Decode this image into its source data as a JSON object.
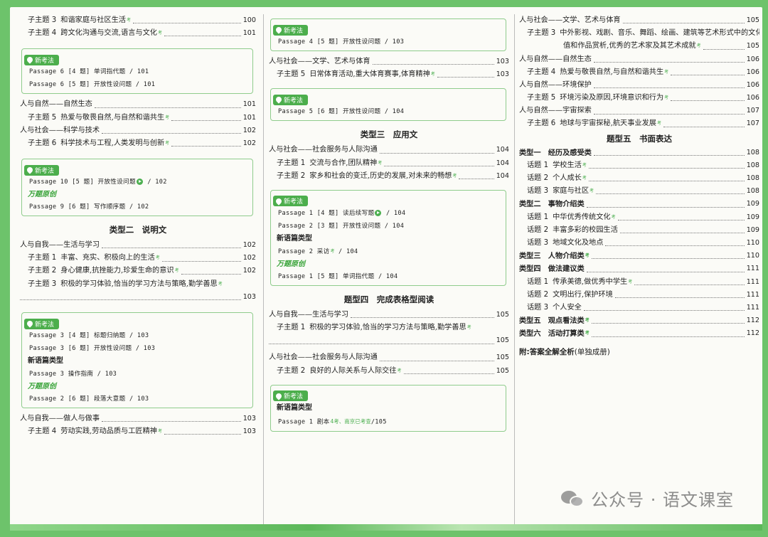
{
  "col1": {
    "r1": {
      "num": "子主题 3",
      "text": "和谐家庭与社区生活",
      "page": "100"
    },
    "r2": {
      "num": "子主题 4",
      "text": "跨文化沟通与交流,语言与文化",
      "page": "101"
    },
    "box1": {
      "badge": "新考法",
      "p1": "Passage 6 [4 题] 单词指代题 / 101",
      "p2": "Passage 6 [5 题] 开放性设问题 / 101"
    },
    "r3": {
      "text": "人与自然——自然生态",
      "page": "101"
    },
    "r4": {
      "num": "子主题 5",
      "text": "热爱与敬畏自然,与自然和谐共生",
      "page": "101"
    },
    "r5": {
      "text": "人与社会——科学与技术",
      "page": "102"
    },
    "r6": {
      "num": "子主题 6",
      "text": "科学技术与工程,人类发明与创新",
      "page": "102"
    },
    "box2": {
      "badge": "新考法",
      "p1": "Passage 10 [5 题] 开放性设问题",
      "p1b": " / 102",
      "label": "万题原创",
      "p2": "Passage 9 [6 题] 写作顺序题 / 102"
    },
    "sec": "类型二　说明文",
    "r7": {
      "text": "人与自我——生活与学习",
      "page": "102"
    },
    "r8": {
      "num": "子主题 1",
      "text": "丰富、充实、积极向上的生活",
      "page": "102"
    },
    "r9": {
      "num": "子主题 2",
      "text": "身心健康,抗挫能力,珍爱生命的意识",
      "page": "102"
    },
    "r10": {
      "num": "子主题 3",
      "text": "积极的学习体验,恰当的学习方法与策略,勤学善思",
      "page": "103"
    },
    "box3": {
      "badge": "新考法",
      "p1": "Passage 3 [4 题] 标题归纳题 / 103",
      "p2": "Passage 3 [6 题] 开放性设问题 / 103",
      "sub": "新语篇类型",
      "p3": "Passage 3 操作指南 / 103",
      "label": "万题原创",
      "p4": "Passage 2 [6 题] 段落大意题 / 103"
    },
    "r11": {
      "text": "人与自我——做人与做事",
      "page": "103"
    },
    "r12": {
      "num": "子主题 4",
      "text": "劳动实践,劳动品质与工匠精神",
      "page": "103"
    }
  },
  "col2": {
    "box1": {
      "badge": "新考法",
      "p1": "Passage 4 [5 题] 开放性设问题 / 103"
    },
    "r1": {
      "text": "人与社会——文学、艺术与体育",
      "page": "103"
    },
    "r2": {
      "num": "子主题 5",
      "text": "日常体育活动,重大体育赛事,体育精神",
      "page": "103"
    },
    "box2": {
      "badge": "新考法",
      "p1": "Passage 5 [6 题] 开放性设问题 / 104"
    },
    "sec1": "类型三　应用文",
    "r3": {
      "text": "人与社会——社会服务与人际沟通",
      "page": "104"
    },
    "r4": {
      "num": "子主题 1",
      "text": "交流与合作,团队精神",
      "page": "104"
    },
    "r5": {
      "num": "子主题 2",
      "text": "家乡和社会的变迁,历史的发展,对未来的畅想",
      "page": "104"
    },
    "box3": {
      "badge": "新考法",
      "p1": "Passage 1 [4 题] 读后续写题",
      "p1b": " / 104",
      "p2": "Passage 2 [3 题] 开放性设问题 / 104",
      "sub": "新语篇类型",
      "p3": "Passage 2 采访",
      "p3b": " / 104",
      "label": "万题原创",
      "p4": "Passage 1 [5 题] 单词指代题 / 104"
    },
    "sec2": "题型四　完成表格型阅读",
    "r6": {
      "text": "人与自我——生活与学习",
      "page": "105"
    },
    "r7": {
      "num": "子主题 1",
      "text": "积极的学习体验,恰当的学习方法与策略,勤学善思",
      "page": "105"
    },
    "r8": {
      "text": "人与社会——社会服务与人际沟通",
      "page": "105"
    },
    "r9": {
      "num": "子主题 2",
      "text": "良好的人际关系与人际交往",
      "page": "105"
    },
    "box4": {
      "badge": "新考法",
      "sub": "新语篇类型",
      "p1": "Passage 1 剧本",
      "tag": "4考、南京已考查",
      "p1b": "/105"
    }
  },
  "col3": {
    "r1": {
      "text": "人与社会——文学、艺术与体育",
      "page": "105"
    },
    "r2": {
      "num": "子主题 3",
      "text": "中外影视、戏剧、音乐、舞蹈、绘画、建筑等艺术形式中的文化价",
      "text2": "值和作品赏析,优秀的艺术家及其艺术成就",
      "page": "105"
    },
    "r3": {
      "text": "人与自然——自然生态",
      "page": "106"
    },
    "r4": {
      "num": "子主题 4",
      "text": "热爱与敬畏自然,与自然和谐共生",
      "page": "106"
    },
    "r5": {
      "text": "人与自然——环境保护",
      "page": "106"
    },
    "r6": {
      "num": "子主题 5",
      "text": "环境污染及原因,环境意识和行为",
      "page": "106"
    },
    "r7": {
      "text": "人与自然——宇宙探索",
      "page": "107"
    },
    "r8": {
      "num": "子主题 6",
      "text": "地球与宇宙探秘,航天事业发展",
      "page": "107"
    },
    "sec": "题型五　书面表达",
    "t1": {
      "text": "类型一　经历及感受类",
      "page": "108"
    },
    "t1a": {
      "num": "话题 1",
      "text": "学校生活",
      "page": "108"
    },
    "t1b": {
      "num": "话题 2",
      "text": "个人成长",
      "page": "108"
    },
    "t1c": {
      "num": "话题 3",
      "text": "家庭与社区",
      "page": "108"
    },
    "t2": {
      "text": "类型二　事物介绍类",
      "page": "109"
    },
    "t2a": {
      "num": "话题 1",
      "text": "中华优秀传统文化",
      "page": "109"
    },
    "t2b": {
      "num": "话题 2",
      "text": "丰富多彩的校园生活",
      "page": "109"
    },
    "t2c": {
      "num": "话题 3",
      "text": "地域文化及地点",
      "page": "110"
    },
    "t3": {
      "text": "类型三　人物介绍类",
      "page": "110"
    },
    "t4": {
      "text": "类型四　做法建议类",
      "page": "111"
    },
    "t4a": {
      "num": "话题 1",
      "text": "传承美德,做优秀中学生",
      "page": "111"
    },
    "t4b": {
      "num": "话题 2",
      "text": "文明出行,保护环境",
      "page": "111"
    },
    "t4c": {
      "num": "话题 3",
      "text": "个人安全",
      "page": "111"
    },
    "t5": {
      "text": "类型五　观点看法类",
      "page": "112"
    },
    "t6": {
      "text": "类型六　活动打算类",
      "page": "112"
    },
    "appendix": "附:答案全解全析",
    "appendix2": "(单独成册)"
  },
  "watermark": "公众号 · 语文课室",
  "tag_small": "考"
}
